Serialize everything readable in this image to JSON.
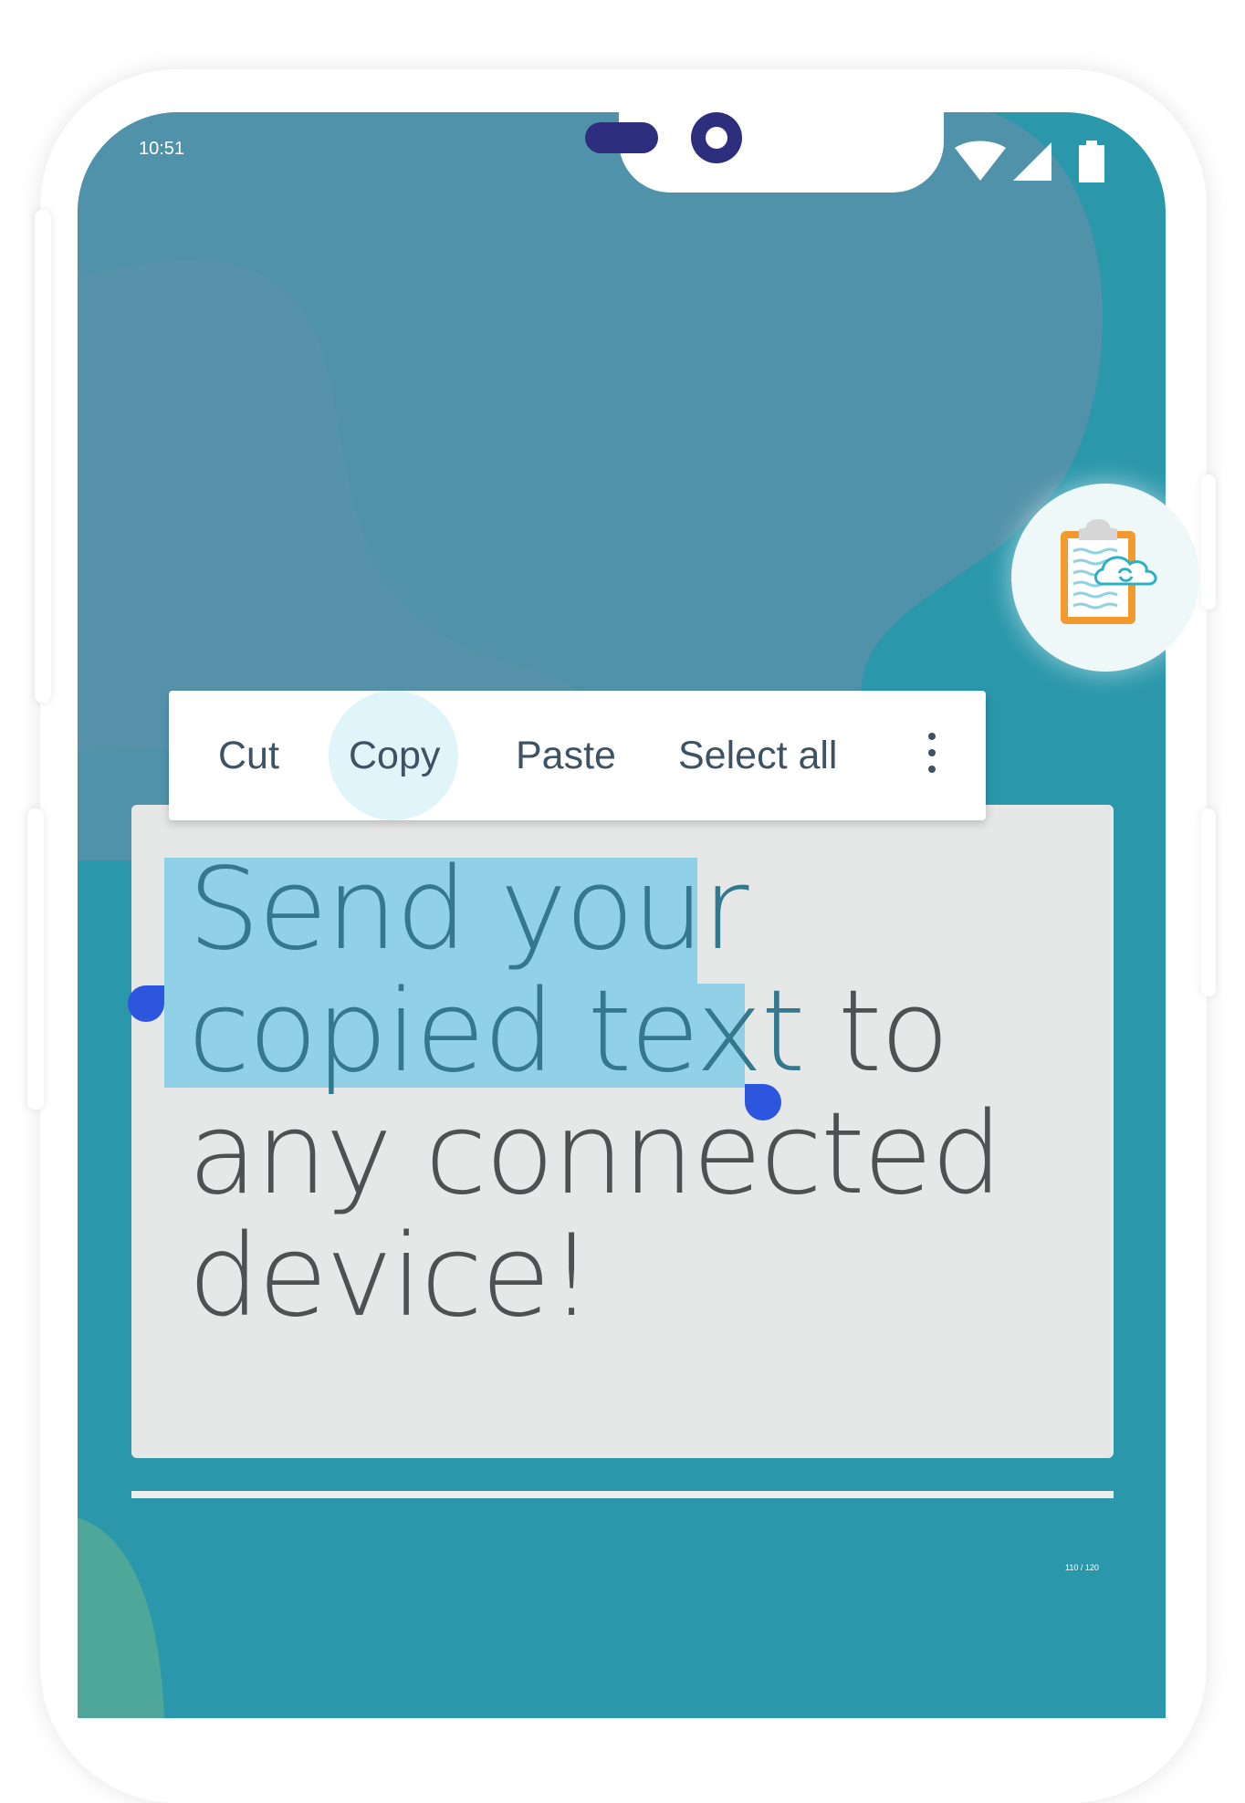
{
  "status_bar": {
    "time": "10:51"
  },
  "context_menu": {
    "cut_label": "Cut",
    "copy_label": "Copy",
    "paste_label": "Paste",
    "select_all_label": "Select all",
    "more_icon": "more-vert-icon"
  },
  "text_card": {
    "selected_text": "Send your\ncopied text",
    "unselected_text": " to\nany connected\ndevice!"
  },
  "floating_button": {
    "icon": "clipboard-cloud-sync-icon"
  },
  "page_indicator": "110 / 120",
  "colors": {
    "screen_background": "#2a97ab",
    "selection_highlight": "#91d1e8",
    "selection_handle": "#2c56de",
    "notch_accent": "#2d2f7e",
    "card_background": "#e6e7e7"
  }
}
